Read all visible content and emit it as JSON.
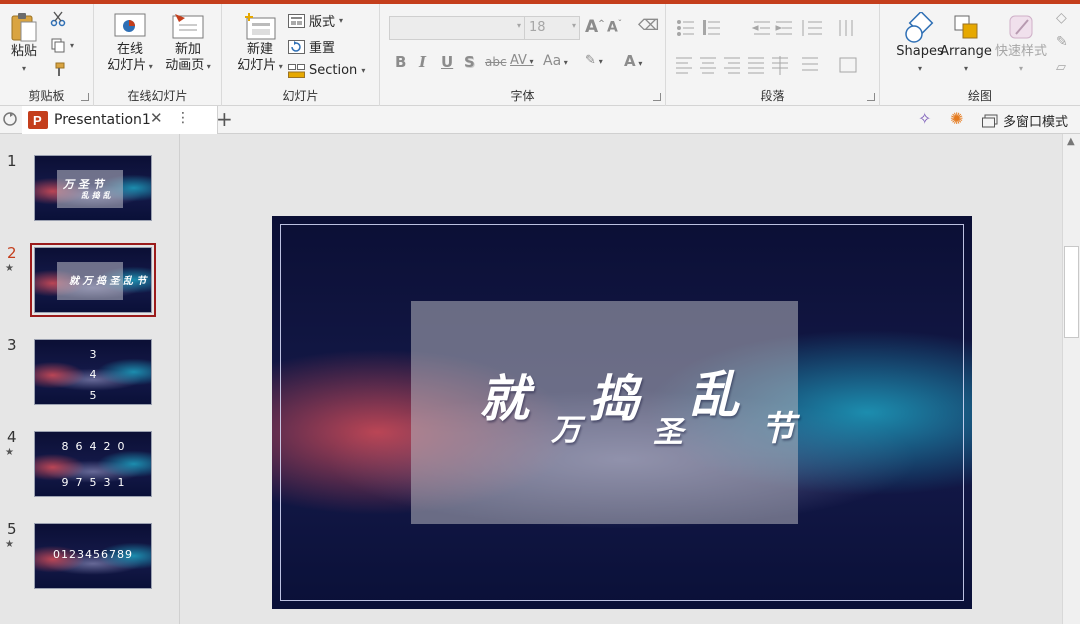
{
  "ribbon": {
    "clipboard": {
      "paste_label": "粘贴",
      "group_label": "剪贴板"
    },
    "online_slides": {
      "online_label_1": "在线",
      "online_label_2": "幻灯片",
      "new_anim_label_1": "新加",
      "new_anim_label_2": "动画页",
      "group_label": "在线幻灯片"
    },
    "slides": {
      "new_slide_label_1": "新建",
      "new_slide_label_2": "幻灯片",
      "layout_label": "版式",
      "reset_label": "重置",
      "section_label": "Section",
      "group_label": "幻灯片"
    },
    "font": {
      "font_name_value": "",
      "font_size_value": "18",
      "group_label": "字体",
      "grow_label": "A",
      "shrink_label": "A",
      "bold": "B",
      "italic": "I",
      "underline": "U",
      "shadow": "S",
      "strike": "abc",
      "spacing": "AV",
      "case": "Aa",
      "color": "A"
    },
    "paragraph": {
      "group_label": "段落"
    },
    "drawing": {
      "shapes_label": "Shapes",
      "arrange_label": "Arrange",
      "quick_styles_label": "快速样式",
      "group_label": "绘图"
    }
  },
  "tabs": {
    "presentation_tab": "Presentation1",
    "multi_window_label": "多窗口模式"
  },
  "thumbnails": [
    {
      "num": "1",
      "star": "",
      "selected": false
    },
    {
      "num": "2",
      "star": "★",
      "selected": true
    },
    {
      "num": "3",
      "star": "",
      "selected": false,
      "lines": [
        "3",
        "4",
        "5"
      ]
    },
    {
      "num": "4",
      "star": "★",
      "selected": false,
      "lines": [
        "8  6  4  2  0",
        "9  7  5  3  1"
      ]
    },
    {
      "num": "5",
      "star": "★",
      "selected": false,
      "lines": [
        "0123456789"
      ]
    }
  ],
  "slide": {
    "chars": [
      "就",
      "万",
      "捣",
      "圣",
      "乱",
      "节"
    ]
  },
  "colors": {
    "accent": "#c43e1c",
    "slide_dark": "#0b0f35",
    "selected_thumb": "#9b1b1b"
  }
}
